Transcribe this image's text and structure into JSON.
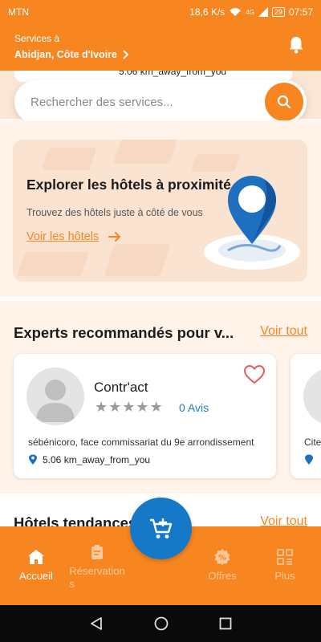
{
  "status_bar": {
    "carrier": "MTN",
    "speed": "18,6 K/s",
    "network": "4G",
    "battery": "29",
    "time": "07:57"
  },
  "header": {
    "label": "Services à",
    "location": "Abidjan, Côte d'Ivoire"
  },
  "peek": {
    "distance": "5.06 km_away_from_you"
  },
  "search": {
    "placeholder": "Rechercher des services..."
  },
  "hotel_banner": {
    "title": "Explorer les hôtels à proximité",
    "subtitle": "Trouvez des hôtels juste à côté de vous",
    "link": "Voir les hôtels"
  },
  "experts": {
    "title": "Experts recommandés pour v...",
    "see_all": "Voir tout",
    "cards": [
      {
        "name": "Contr'act",
        "rating": 0,
        "reviews": "0 Avis",
        "address": "sébénicoro, face commissariat du 9e arrondissement",
        "distance": "5.06 km_away_from_you"
      },
      {
        "address": "Cite"
      }
    ]
  },
  "trending": {
    "title": "Hôtels tendances",
    "see_all": "Voir tout"
  },
  "nav": {
    "items": [
      {
        "label": "Accueil",
        "icon": "home-icon",
        "active": true
      },
      {
        "label": "Réservation\ns",
        "icon": "clipboard-icon",
        "active": false
      },
      {
        "label": "Offres",
        "icon": "discount-icon",
        "active": false
      },
      {
        "label": "Plus",
        "icon": "grid-icon",
        "active": false
      }
    ],
    "fab_icon": "cart-add-icon"
  },
  "colors": {
    "primary": "#f78520",
    "accent_blue": "#1679c8",
    "heart": "#e65b5b"
  }
}
